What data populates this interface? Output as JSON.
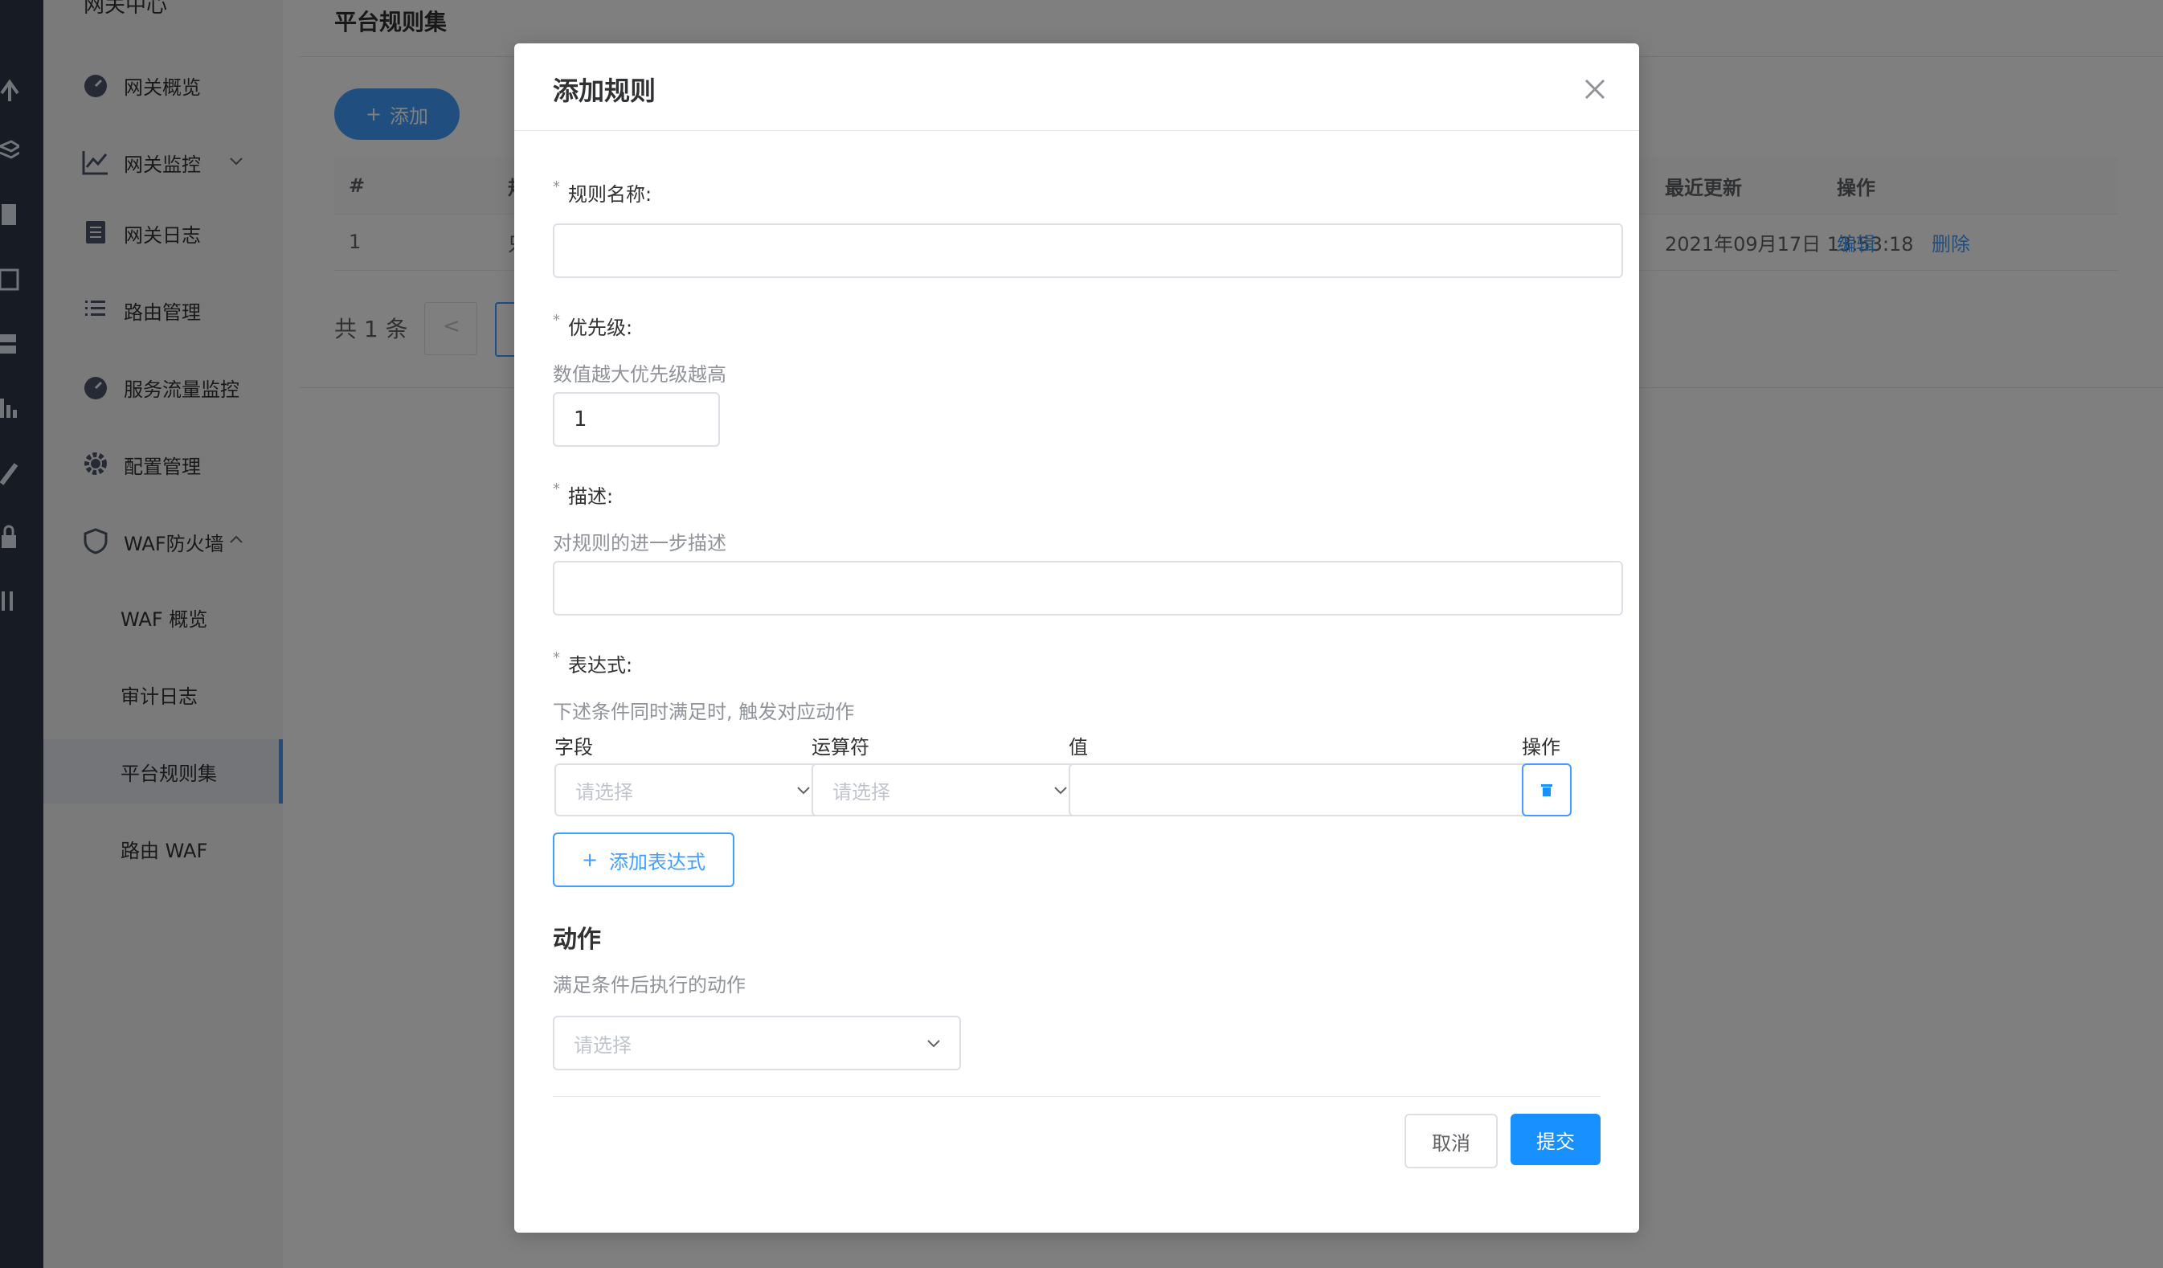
{
  "sidebar": {
    "title": "网关中心",
    "items": [
      {
        "label": "网关概览",
        "icon": "dashboard-icon"
      },
      {
        "label": "网关监控",
        "icon": "line-chart-icon"
      },
      {
        "label": "网关日志",
        "icon": "document-icon"
      },
      {
        "label": "路由管理",
        "icon": "list-icon"
      },
      {
        "label": "服务流量监控",
        "icon": "dashboard-icon"
      },
      {
        "label": "配置管理",
        "icon": "gear-icon"
      },
      {
        "label": "WAF防火墙",
        "icon": "shield-icon"
      }
    ],
    "sub_items": [
      {
        "label": "WAF 概览"
      },
      {
        "label": "审计日志"
      },
      {
        "label": "平台规则集"
      },
      {
        "label": "路由 WAF"
      }
    ]
  },
  "main": {
    "page_title": "平台规则集",
    "add_label": "添加",
    "table": {
      "headers": [
        "#",
        "规",
        "最近更新",
        "操作"
      ],
      "rows": [
        {
          "index": "1",
          "name": "只",
          "updated": "2021年09月17日 13:53:18",
          "edit": "编辑",
          "delete": "删除"
        }
      ]
    },
    "pager": {
      "total": "共 1 条",
      "prev": "<"
    }
  },
  "dialog": {
    "title": "添加规则",
    "fields": {
      "rule_name": {
        "label": "规则名称:",
        "value": ""
      },
      "priority": {
        "label": "优先级:",
        "hint": "数值越大优先级越高",
        "value": "1"
      },
      "description": {
        "label": "描述:",
        "hint": "对规则的进一步描述",
        "value": ""
      },
      "expression": {
        "label": "表达式:",
        "hint": "下述条件同时满足时, 触发对应动作",
        "columns": [
          "字段",
          "运算符",
          "值",
          "操作"
        ],
        "field_placeholder": "请选择",
        "operator_placeholder": "请选择",
        "value": "",
        "add_label": "添加表达式"
      }
    },
    "action": {
      "title": "动作",
      "hint": "满足条件后执行的动作",
      "placeholder": "请选择"
    },
    "buttons": {
      "cancel": "取消",
      "submit": "提交"
    }
  }
}
